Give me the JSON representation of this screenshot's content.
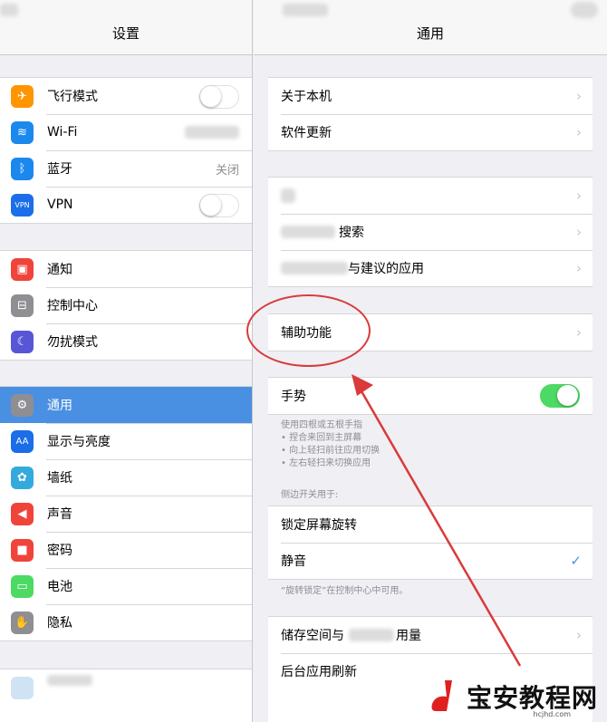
{
  "left": {
    "title": "设置",
    "groups": [
      [
        {
          "label": "飞行模式",
          "icon": "airplane-icon",
          "color": "#ff9500",
          "glyph": "✈",
          "toggle": "off"
        },
        {
          "label": "Wi-Fi",
          "icon": "wifi-icon",
          "color": "#1b88ee",
          "glyph": "≋"
        },
        {
          "label": "蓝牙",
          "value": "关闭",
          "icon": "bluetooth-icon",
          "color": "#1b88ee",
          "glyph": "ᛒ"
        },
        {
          "label": "VPN",
          "icon": "vpn-icon",
          "color": "#1b6ee8",
          "glyph": "VPN",
          "toggle": "off"
        }
      ],
      [
        {
          "label": "通知",
          "icon": "notifications-icon",
          "color": "#f0443a",
          "glyph": "▣"
        },
        {
          "label": "控制中心",
          "icon": "control-center-icon",
          "color": "#8e8e93",
          "glyph": "⊟"
        },
        {
          "label": "勿扰模式",
          "icon": "moon-icon",
          "color": "#5856d6",
          "glyph": "☾"
        }
      ],
      [
        {
          "label": "通用",
          "icon": "gear-icon",
          "color": "#8e8e93",
          "glyph": "⚙",
          "selected": true
        },
        {
          "label": "显示与亮度",
          "icon": "display-icon",
          "color": "#1b6ee8",
          "glyph": "AA"
        },
        {
          "label": "墙纸",
          "icon": "wallpaper-icon",
          "color": "#34aadc",
          "glyph": "✿"
        },
        {
          "label": "声音",
          "icon": "sound-icon",
          "color": "#f0443a",
          "glyph": "◀"
        },
        {
          "label": "密码",
          "icon": "lock-icon",
          "color": "#f0443a",
          "glyph": "🔒"
        },
        {
          "label": "电池",
          "icon": "battery-icon",
          "color": "#4cd964",
          "glyph": "▭"
        },
        {
          "label": "隐私",
          "icon": "hand-icon",
          "color": "#8e8e93",
          "glyph": "✋"
        }
      ]
    ]
  },
  "right": {
    "title": "通用",
    "group1": [
      "关于本机",
      "软件更新"
    ],
    "group2": [
      "",
      "搜索",
      "与建议的应用"
    ],
    "accessibility": "辅助功能",
    "gesture": {
      "label": "手势",
      "toggle": "on"
    },
    "gesture_desc": [
      "使用四根或五根手指",
      "• 捏合来回到主屏幕",
      "• 向上轻扫前往应用切换",
      "• 左右轻扫来切换应用"
    ],
    "side_switch_header": "侧边开关用于:",
    "side_switch": [
      {
        "label": "锁定屏幕旋转"
      },
      {
        "label": "静音",
        "checked": true
      }
    ],
    "rotation_note": "“旋转锁定”在控制中心中可用。",
    "group5": [
      "储存空间与",
      "用量",
      "后台应用刷新"
    ]
  },
  "watermark": {
    "text": "宝安教程网",
    "url": "hcjhd.com"
  },
  "colors": {
    "accent": "#4a90e2",
    "annotation": "#d93a3a",
    "toggle_on": "#4cd964"
  }
}
